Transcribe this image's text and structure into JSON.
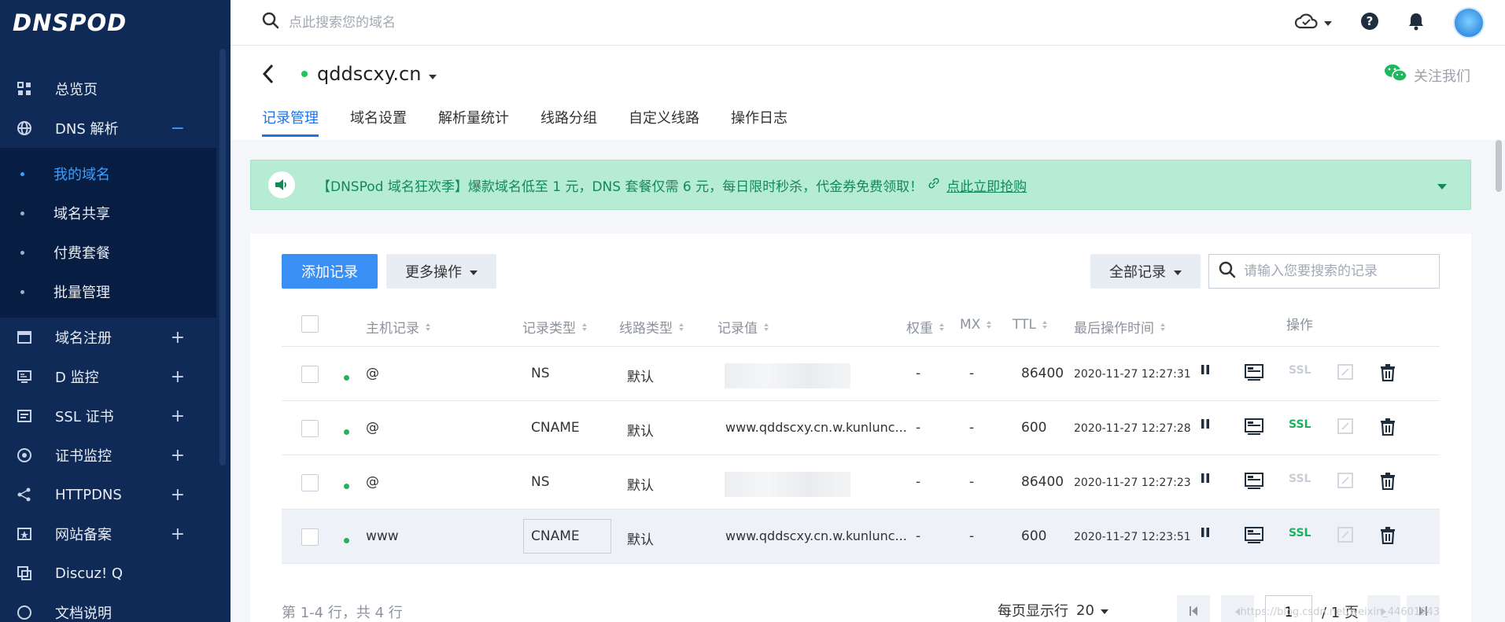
{
  "sidebar": {
    "logo": "DNSPOD",
    "items": [
      {
        "label": "总览页",
        "icon": "grid-icon",
        "pm": ""
      },
      {
        "label": "DNS 解析",
        "icon": "globe-icon",
        "pm": "−"
      }
    ],
    "sub_items": [
      {
        "label": "我的域名",
        "active": true
      },
      {
        "label": "域名共享",
        "active": false
      },
      {
        "label": "付费套餐",
        "active": false
      },
      {
        "label": "批量管理",
        "active": false
      }
    ],
    "items2": [
      {
        "label": "域名注册",
        "icon": "window-icon",
        "pm": "+"
      },
      {
        "label": "D 监控",
        "icon": "monitor-icon",
        "pm": "+"
      },
      {
        "label": "SSL 证书",
        "icon": "certificate-icon",
        "pm": "+"
      },
      {
        "label": "证书监控",
        "icon": "target-icon",
        "pm": "+"
      },
      {
        "label": "HTTPDNS",
        "icon": "network-icon",
        "pm": "+"
      },
      {
        "label": "网站备案",
        "icon": "record-icon",
        "pm": "+"
      },
      {
        "label": "Discuz! Q",
        "icon": "discuz-icon",
        "pm": ""
      },
      {
        "label": "文档说明",
        "icon": "doc-icon",
        "pm": ""
      }
    ]
  },
  "topbar": {
    "search_placeholder": "点此搜索您的域名"
  },
  "domain": {
    "name": "qddscxy.cn",
    "follow": "关注我们",
    "tabs": [
      "记录管理",
      "域名设置",
      "解析量统计",
      "线路分组",
      "自定义线路",
      "操作日志"
    ]
  },
  "banner": {
    "text": "【DNSPod 域名狂欢季】爆款域名低至 1 元，DNS 套餐仅需 6 元，每日限时秒杀，代金券免费领取！",
    "link": "点此立即抢购"
  },
  "toolbar": {
    "add": "添加记录",
    "more": "更多操作",
    "filter": "全部记录",
    "search_placeholder": "请输入您要搜索的记录"
  },
  "table": {
    "headers": {
      "host": "主机记录",
      "type": "记录类型",
      "line": "线路类型",
      "value": "记录值",
      "weight": "权重",
      "mx": "MX",
      "ttl": "TTL",
      "time": "最后操作时间",
      "ops": "操作"
    },
    "rows": [
      {
        "host": "@",
        "type": "NS",
        "line": "默认",
        "value": "",
        "weight": "-",
        "mx": "-",
        "ttl": "86400",
        "time": "2020-11-27 12:27:31",
        "ssl": "SSL",
        "ssl_on": false,
        "hl": false
      },
      {
        "host": "@",
        "type": "CNAME",
        "line": "默认",
        "value": "www.qddscxy.cn.w.kunlunc...",
        "weight": "-",
        "mx": "-",
        "ttl": "600",
        "time": "2020-11-27 12:27:28",
        "ssl": "SSL",
        "ssl_on": true,
        "hl": false
      },
      {
        "host": "@",
        "type": "NS",
        "line": "默认",
        "value": "",
        "weight": "-",
        "mx": "-",
        "ttl": "86400",
        "time": "2020-11-27 12:27:23",
        "ssl": "SSL",
        "ssl_on": false,
        "hl": false
      },
      {
        "host": "www",
        "type": "CNAME",
        "line": "默认",
        "value": "www.qddscxy.cn.w.kunlunc...",
        "weight": "-",
        "mx": "-",
        "ttl": "600",
        "time": "2020-11-27 12:23:51",
        "ssl": "SSL",
        "ssl_on": true,
        "hl": true
      }
    ]
  },
  "footer": {
    "info": "第 1-4 行，共 4 行",
    "page_size_label": "每页显示行",
    "page_size": "20",
    "page": "1",
    "total": "/ 1 页",
    "watermark": "https://blog.csdn.net/weixin_44601943"
  },
  "colors": {
    "sidebar": "#0f2a57",
    "primary": "#3a8ff5",
    "banner": "#b6ecd3",
    "ssl_on": "#1db05f"
  }
}
